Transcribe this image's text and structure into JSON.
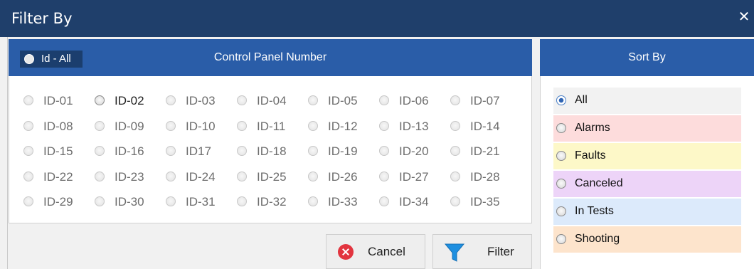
{
  "window": {
    "title": "Filter By",
    "close_glyph": "✕"
  },
  "control_panel": {
    "header_title": "Control Panel Number",
    "id_all_label": "Id - All",
    "ids": [
      "ID-01",
      "ID-02",
      "ID-03",
      "ID-04",
      "ID-05",
      "ID-06",
      "ID-07",
      "ID-08",
      "ID-09",
      "ID-10",
      "ID-11",
      "ID-12",
      "ID-13",
      "ID-14",
      "ID-15",
      "ID-16",
      "ID17",
      "ID-18",
      "ID-19",
      "ID-20",
      "ID-21",
      "ID-22",
      "ID-23",
      "ID-24",
      "ID-25",
      "ID-26",
      "ID-27",
      "ID-28",
      "ID-29",
      "ID-30",
      "ID-31",
      "ID-32",
      "ID-33",
      "ID-34",
      "ID-35"
    ],
    "checked_id": "ID-02"
  },
  "sort_by": {
    "header_title": "Sort By",
    "selected": "All",
    "options": [
      {
        "label": "All",
        "color": "#f2f2f2"
      },
      {
        "label": "Alarms",
        "color": "#fddcdc"
      },
      {
        "label": "Faults",
        "color": "#fdf8c8"
      },
      {
        "label": "Canceled",
        "color": "#edd4f8"
      },
      {
        "label": "In Tests",
        "color": "#dceafb"
      },
      {
        "label": "Shooting",
        "color": "#fde4cc"
      }
    ]
  },
  "buttons": {
    "cancel_label": "Cancel",
    "cancel_icon": "cancel-circle-icon",
    "filter_label": "Filter",
    "filter_icon": "funnel-icon"
  },
  "colors": {
    "titlebar": "#1f3f6b",
    "group_header": "#2a5da8",
    "id_all_bg": "#1b3e6e",
    "funnel": "#1e8fe0",
    "cancel_red": "#e2343f"
  }
}
